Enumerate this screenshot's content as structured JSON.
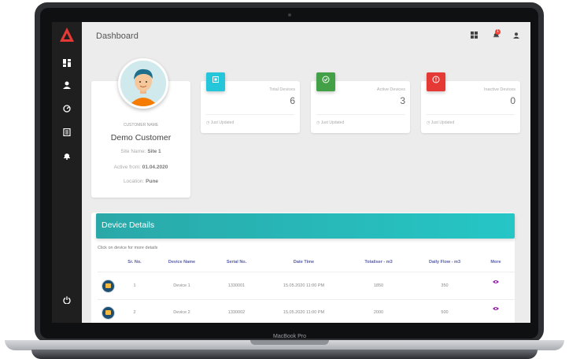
{
  "laptop": {
    "label": "MacBook Pro"
  },
  "app": {
    "title": "Dashboard",
    "logo_color": "#e53935"
  },
  "sidebar": {
    "icons": [
      "dashboard-icon",
      "user-icon",
      "speedometer-icon",
      "book-icon",
      "bell-icon",
      "power-icon"
    ]
  },
  "topbar": {
    "notification_count": "1"
  },
  "customer": {
    "label": "CUSTOMER NAME",
    "name": "Demo Customer",
    "site_label": "Site Name:",
    "site_value": "Site 1",
    "active_label": "Active from:",
    "active_value": "01.04.2020",
    "location_label": "Location:",
    "location_value": "Pune"
  },
  "stats": [
    {
      "label": "Total Devices",
      "value": "6",
      "footer": "Just Updated",
      "color": "#26c6da",
      "icon": "chip-icon"
    },
    {
      "label": "Active Devices",
      "value": "3",
      "footer": "Just Updated",
      "color": "#43a047",
      "icon": "check-circle-icon"
    },
    {
      "label": "Inactive Devices",
      "value": "0",
      "footer": "Just Updated",
      "color": "#e53935",
      "icon": "alert-circle-icon"
    }
  ],
  "device_details": {
    "title": "Device Details",
    "hint": "Click on device for more details",
    "columns": [
      "Sr. No.",
      "Device Name",
      "Serial No.",
      "Date Time",
      "Totaliser - m3",
      "Daily Flow - m3",
      "More"
    ],
    "rows": [
      {
        "sr": "1",
        "name": "Device 1",
        "serial": "1330001",
        "datetime": "15.05.2020 11:00 PM",
        "totaliser": "1850",
        "daily": "350"
      },
      {
        "sr": "2",
        "name": "Device 2",
        "serial": "1330002",
        "datetime": "15.05.2020 11:00 PM",
        "totaliser": "2000",
        "daily": "500"
      }
    ]
  }
}
